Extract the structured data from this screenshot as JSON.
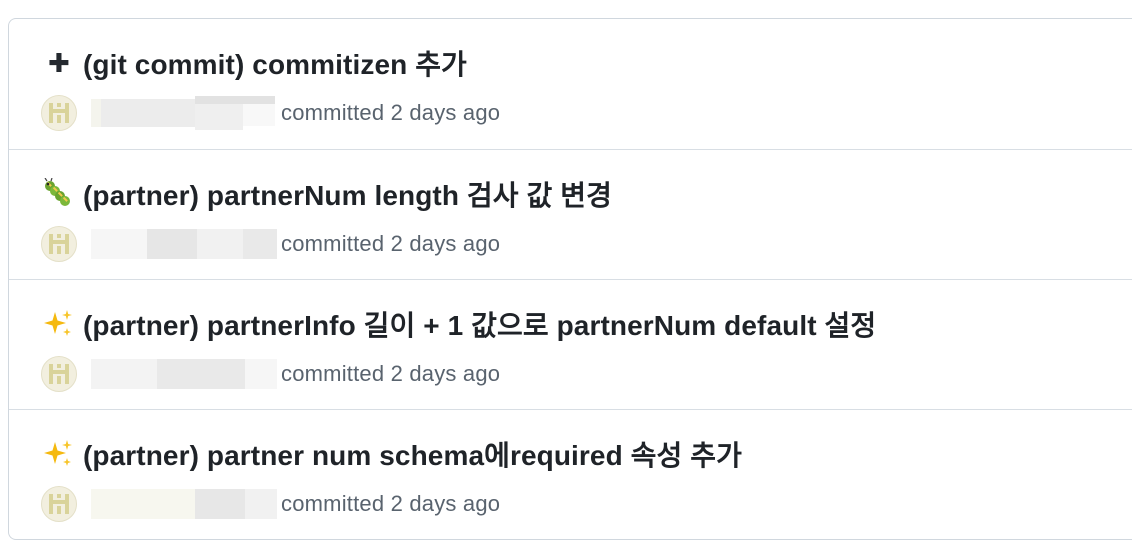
{
  "commits": [
    {
      "icon": "plus-icon",
      "glyph": "➕",
      "title": "(git commit) commitizen 추가",
      "committed_label": "committed",
      "time": "2 days ago"
    },
    {
      "icon": "bug-icon",
      "glyph": "🐛",
      "title": "(partner) partnerNum length 검사 값 변경",
      "committed_label": "committed",
      "time": "2 days ago"
    },
    {
      "icon": "sparkles-icon",
      "glyph": "✨",
      "title": "(partner) partnerInfo 길이 + 1 값으로 partnerNum default 설정",
      "committed_label": "committed",
      "time": "2 days ago"
    },
    {
      "icon": "sparkles-icon",
      "glyph": "✨",
      "title": "(partner) partner num schema에required 속성 추가",
      "committed_label": "committed",
      "time": "2 days ago"
    }
  ],
  "colors": {
    "border": "#d0d7de",
    "title": "#1f2328",
    "muted": "#59636e",
    "avatar_bg": "#f2efdf",
    "avatar_fg": "#d9d39a"
  }
}
